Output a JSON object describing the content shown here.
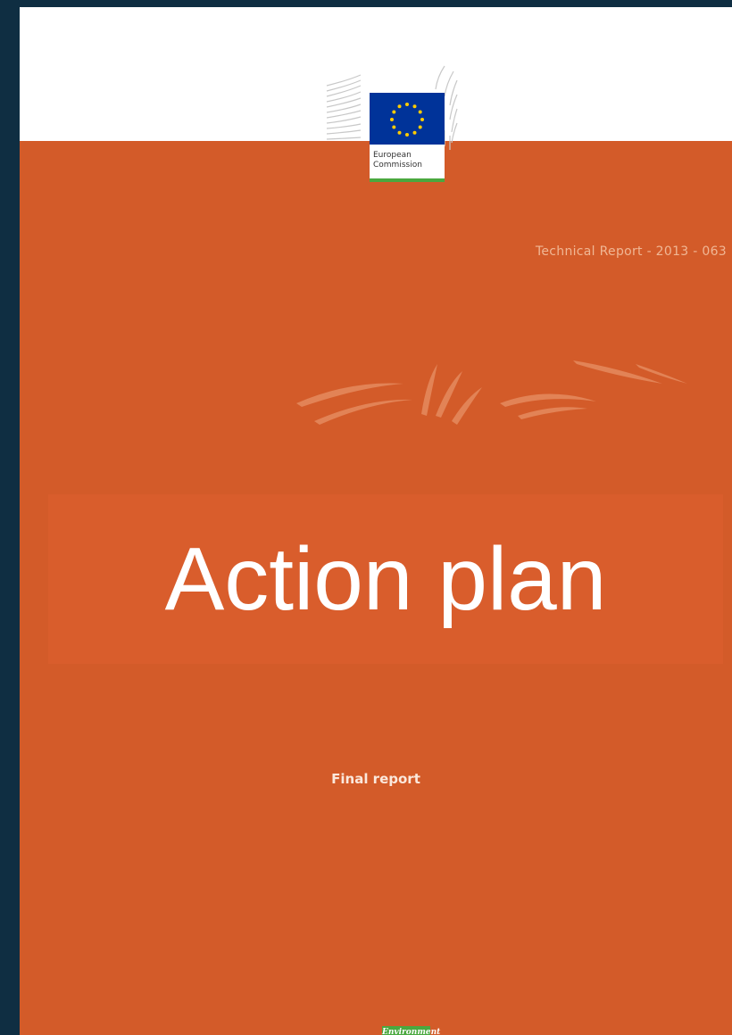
{
  "cover": {
    "logo": {
      "line1": "European",
      "line2": "Commission",
      "flag_color": "#003399",
      "star_color": "#ffcc00",
      "accent_color": "#4aa83f"
    },
    "report_id": "Technical Report - 2013 - 063",
    "title": "Action plan",
    "subtitle": "Final report",
    "badge": "Environment",
    "colors": {
      "background": "#d35b29",
      "frame": "#0f2e42",
      "badge": "#4aa83f"
    }
  }
}
